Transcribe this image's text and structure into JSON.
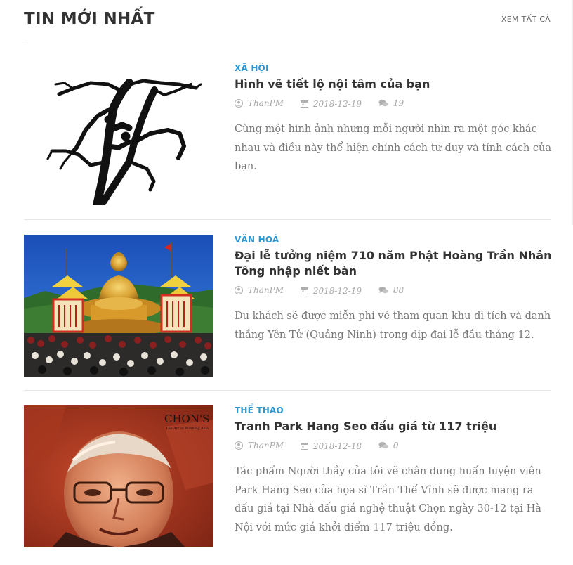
{
  "section": {
    "title": "TIN MỚI NHẤT",
    "see_all_label": "XEM TẤT CẢ"
  },
  "articles": [
    {
      "category": "XÃ HỘI",
      "title": "Hình vẽ tiết lộ nội tâm của bạn",
      "author": "ThanPM",
      "date": "2018-12-19",
      "comments": "19",
      "excerpt": "Cùng một hình ảnh nhưng mỗi người nhìn ra một góc khác nhau và điều này thể hiện chính cách tư duy và tính cách của bạn.",
      "image": "tree-silhouette-illustration"
    },
    {
      "category": "VĂN HOÁ",
      "title": "Đại lễ tưởng niệm 710 năm Phật Hoàng Trần Nhân Tông nhập niết bàn",
      "author": "ThanPM",
      "date": "2018-12-19",
      "comments": "88",
      "excerpt": "Du khách sẽ được miễn phí vé tham quan khu di tích và danh thắng Yên Tử (Quảng Ninh) trong dịp đại lễ đầu tháng 12.",
      "image": "golden-buddha-statue-ceremony-photo"
    },
    {
      "category": "THỂ THAO",
      "title": "Tranh Park Hang Seo đấu giá từ 117 triệu",
      "author": "ThanPM",
      "date": "2018-12-18",
      "comments": "0",
      "excerpt": "Tác phẩm Người thầy của tôi vẽ chân dung huấn luyện viên Park Hang Seo của họa sĩ Trần Thế Vĩnh sẽ được mang ra đấu giá tại Nhà đấu giá nghệ thuật Chọn ngày 30-12 tại Hà Nội với mức giá khởi điểm 117 triệu đồng.",
      "image": "portrait-painting",
      "image_brand_text": "CHON'S",
      "image_brand_subtitle": "The Art of Running Asia"
    }
  ],
  "icons": {
    "author": "user-icon",
    "date": "calendar-icon",
    "comments": "comments-icon"
  },
  "colors": {
    "accent": "#2a97d3",
    "title": "#333333",
    "meta": "#a8a8a8",
    "excerpt": "#777777"
  }
}
